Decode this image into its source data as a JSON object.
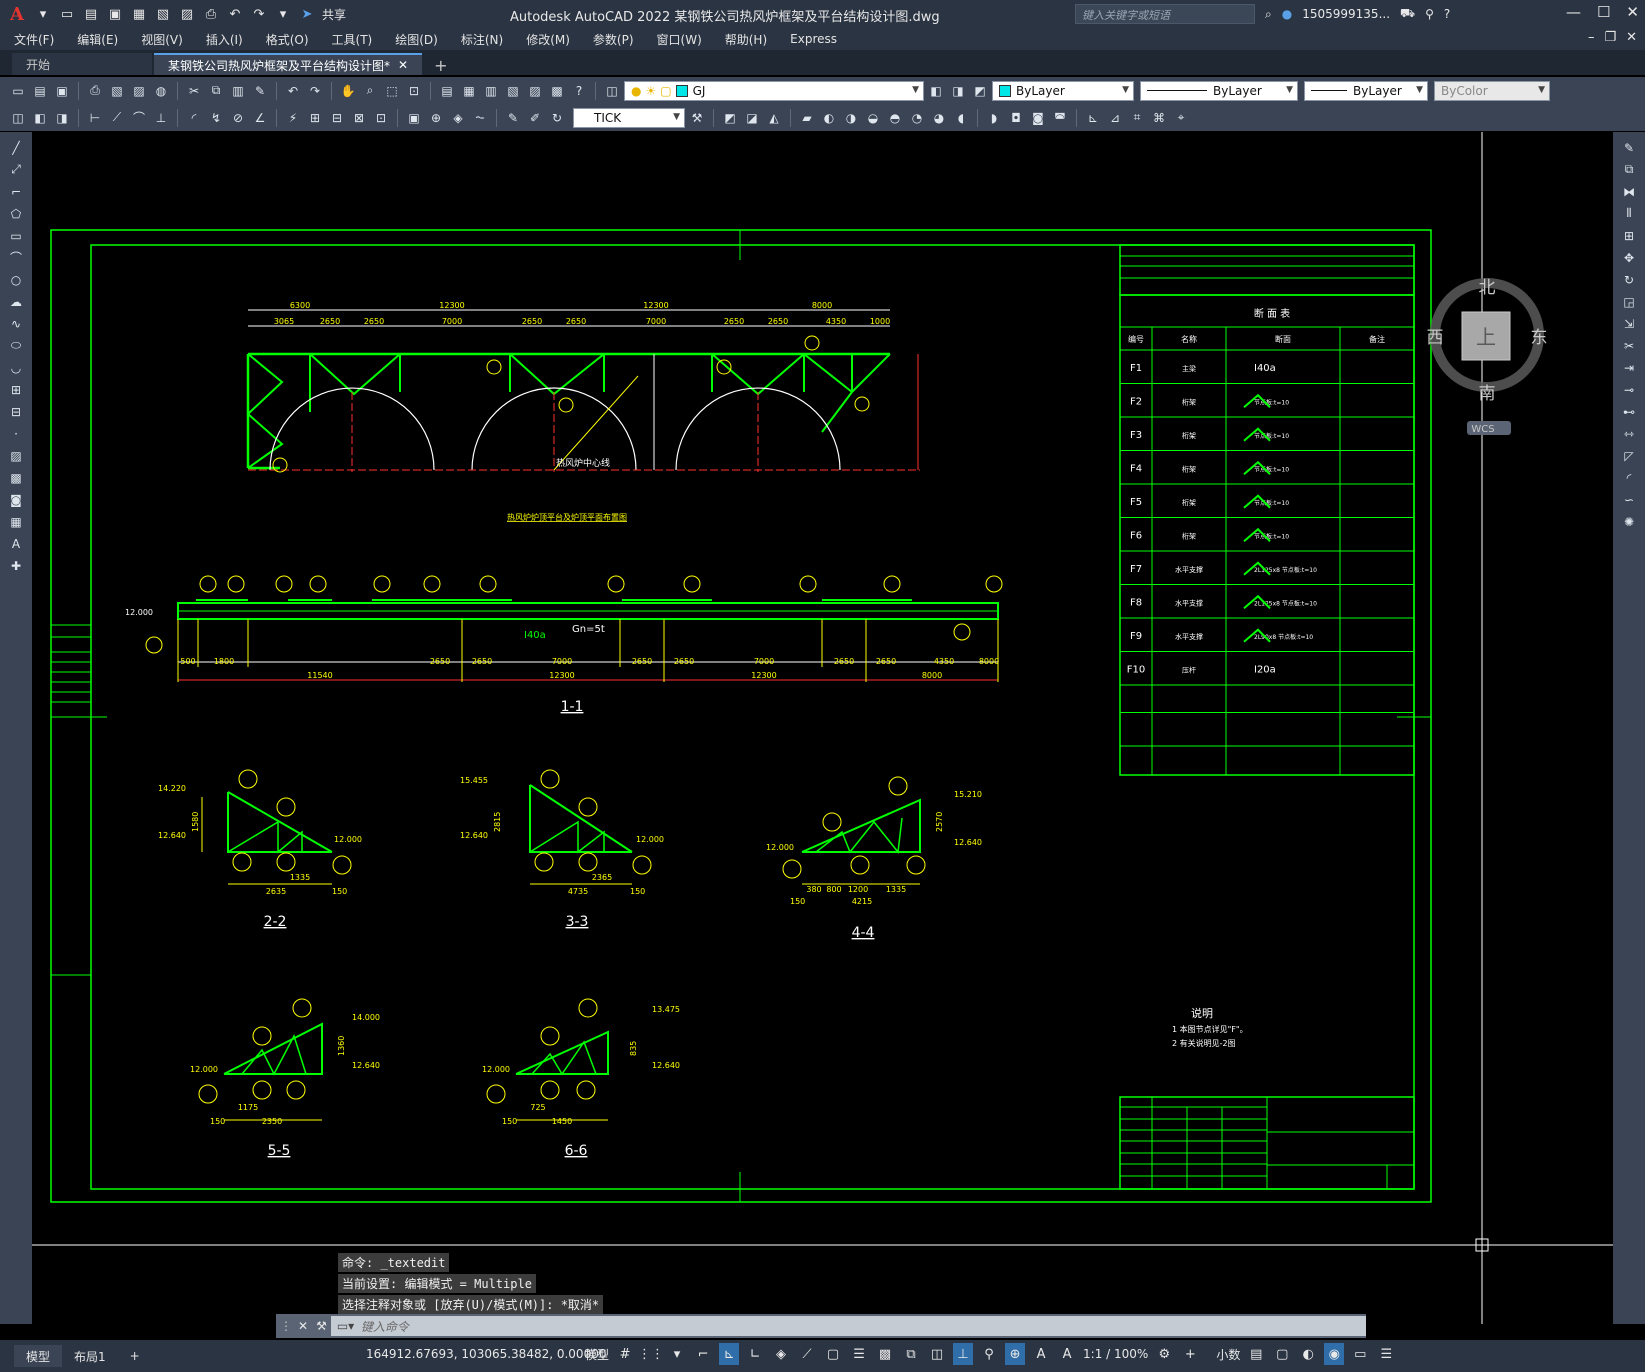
{
  "window": {
    "title": "Autodesk AutoCAD 2022    某钢铁公司热风炉框架及平台结构设计图.dwg",
    "share_label": "共享",
    "search_placeholder": "键入关键字或短语",
    "user": "1505999135...",
    "logo": "A"
  },
  "menu": [
    "文件(F)",
    "编辑(E)",
    "视图(V)",
    "插入(I)",
    "格式(O)",
    "工具(T)",
    "绘图(D)",
    "标注(N)",
    "修改(M)",
    "参数(P)",
    "窗口(W)",
    "帮助(H)",
    "Express"
  ],
  "tabs": {
    "start": "开始",
    "active": "某钢铁公司热风炉框架及平台结构设计图*"
  },
  "toolbar": {
    "layer": "GJ",
    "color": "ByLayer",
    "linetype": "ByLayer",
    "lineweight": "ByLayer",
    "plotstyle": "ByColor",
    "dimstyle": "TICK",
    "layer_color": "#00e5e5"
  },
  "viewcube": {
    "north": "北",
    "south": "南",
    "east": "东",
    "west": "西",
    "top": "上",
    "wcs": "WCS"
  },
  "drawing": {
    "plan_title": "热风炉炉顶平台及炉顶平面布置图",
    "center_label": "热风炉中心线",
    "elev_marks": {
      "a": "12.000",
      "b": "Gn=5t",
      "c": "I40a"
    },
    "plan_dims_top": [
      "6300",
      "12300",
      "12300",
      "8000"
    ],
    "plan_dims_sub": [
      "3065",
      "2650",
      "2650",
      "7000",
      "2650",
      "2650",
      "7000",
      "2650",
      "2650",
      "4350",
      "1000"
    ],
    "sect_dims_bottom": [
      "500",
      "1800",
      "2650",
      "2650",
      "7000",
      "2650",
      "2650",
      "7000",
      "2650",
      "2650",
      "4350",
      "8000"
    ],
    "sect_dims_total": [
      "11540",
      "12300",
      "12300",
      "8000"
    ],
    "sections": [
      "1-1",
      "2-2",
      "3-3",
      "4-4",
      "5-5",
      "6-6"
    ],
    "table_title": "断 面 表",
    "table_headers": [
      "编号",
      "名称",
      "断面",
      "备注"
    ],
    "table_rows": [
      {
        "id": "F1",
        "name": "主梁",
        "sect": "I40a"
      },
      {
        "id": "F2",
        "name": "桁架",
        "sect": "节点板:t=10"
      },
      {
        "id": "F3",
        "name": "桁架",
        "sect": "节点板:t=10"
      },
      {
        "id": "F4",
        "name": "桁架",
        "sect": "节点板:t=10"
      },
      {
        "id": "F5",
        "name": "桁架",
        "sect": "节点板:t=10"
      },
      {
        "id": "F6",
        "name": "桁架",
        "sect": "节点板:t=10"
      },
      {
        "id": "F7",
        "name": "水平支撑",
        "sect": "2L125x8 节点板:t=10"
      },
      {
        "id": "F8",
        "name": "水平支撑",
        "sect": "2L125x8 节点板:t=10"
      },
      {
        "id": "F9",
        "name": "水平支撑",
        "sect": "2L90x8 节点板:t=10"
      },
      {
        "id": "F10",
        "name": "压杆",
        "sect": "I20a"
      }
    ],
    "notes_title": "说明",
    "notes": [
      "1 本图节点详见\"F\"。",
      "2 有关说明见-2图"
    ],
    "sec22": {
      "top": "14.220",
      "mid": "12.640",
      "right": "12.000",
      "h": "1580",
      "w": "2635",
      "w2": "1335",
      "e": "150"
    },
    "sec33": {
      "top": "15.455",
      "mid": "12.640",
      "right": "12.000",
      "h": "2815",
      "w": "4735",
      "w2": "2365",
      "e": "150"
    },
    "sec44": {
      "top": "15.210",
      "mid": "12.640",
      "left": "12.000",
      "h": "2570",
      "w": "4215",
      "d1": "380",
      "d2": "800",
      "d3": "1200",
      "d4": "1335",
      "e": "150"
    },
    "sec55": {
      "top": "14.000",
      "mid": "12.640",
      "left": "12.000",
      "h": "1360",
      "w": "2350",
      "w2": "1175",
      "e": "150"
    },
    "sec66": {
      "top": "13.475",
      "mid": "12.640",
      "left": "12.000",
      "h": "835",
      "w": "1450",
      "w2": "725",
      "e": "150"
    }
  },
  "command": {
    "history": [
      "命令: _textedit",
      "当前设置: 编辑模式 = Multiple",
      "选择注释对象或 [放弃(U)/模式(M)]: *取消*"
    ],
    "placeholder": "键入命令"
  },
  "status": {
    "tab_model": "模型",
    "tab_layout": "布局1",
    "coords": "164912.67693, 103065.38482, 0.00000",
    "model_label": "模型",
    "scale": "1:1 / 100%",
    "units": "小数"
  }
}
